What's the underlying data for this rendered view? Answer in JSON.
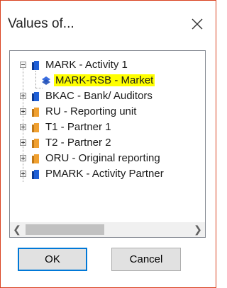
{
  "dialog": {
    "title": "Values of...",
    "close_icon": "close-x-icon"
  },
  "tree": {
    "items": [
      {
        "label": "MARK - Activity 1",
        "icon": "blue-book-icon",
        "expanded": true
      },
      {
        "label": "MARK-RSB - Market",
        "icon": "blue-diamond-stack-icon",
        "highlighted": true
      },
      {
        "label": "BKAC - Bank/ Auditors",
        "icon": "blue-book-icon"
      },
      {
        "label": "RU - Reporting unit",
        "icon": "orange-book-icon"
      },
      {
        "label": "T1 - Partner 1",
        "icon": "orange-book-icon"
      },
      {
        "label": "T2 - Partner 2",
        "icon": "orange-book-icon"
      },
      {
        "label": "ORU - Original reporting",
        "icon": "orange-book-icon"
      },
      {
        "label": "PMARK - Activity Partner",
        "icon": "blue-book-icon"
      }
    ],
    "highlight_color": "#ffff00"
  },
  "buttons": {
    "ok_label": "OK",
    "cancel_label": "Cancel"
  },
  "colors": {
    "window_border": "#d9411f",
    "default_button_border": "#0078d7",
    "blue_icon": "#1f5fd6",
    "orange_icon": "#f0a030"
  }
}
